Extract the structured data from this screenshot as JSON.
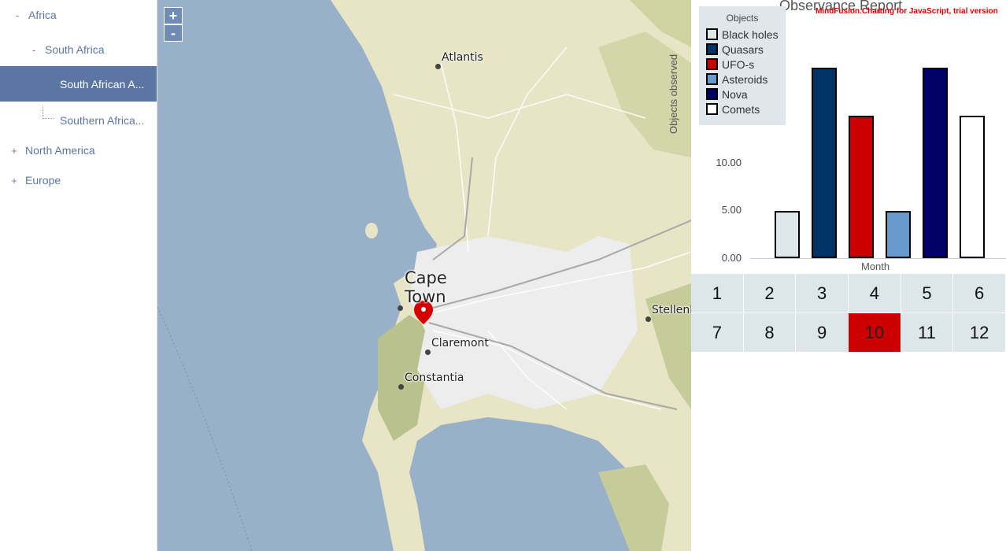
{
  "tree": {
    "nodes": [
      {
        "toggle": "-",
        "label": "Africa"
      },
      {
        "toggle": "-",
        "label": "South Africa"
      },
      {
        "toggle": "",
        "label": "South African A..."
      },
      {
        "toggle": "",
        "label": "Southern Africa..."
      },
      {
        "toggle": "+",
        "label": "North America"
      },
      {
        "toggle": "+",
        "label": "Europe"
      }
    ]
  },
  "map": {
    "zoom_in": "+",
    "zoom_out": "-",
    "labels": {
      "atlantis": "Atlantis",
      "cape": "Cape",
      "town": "Town",
      "claremont": "Claremont",
      "constantia": "Constantia",
      "stellenbosch": "Stellenb"
    }
  },
  "chart": {
    "title": "Observance Report",
    "trial_notice": "MindFusion.Charting for JavaScript, trial version",
    "legend_title": "Objects",
    "ylabel": "Objects observed",
    "xlabel": "Month",
    "yticks": [
      "10.00",
      "5.00",
      "0.00"
    ]
  },
  "chart_data": {
    "type": "bar",
    "categories": [
      "Black holes",
      "Quasars",
      "UFO-s",
      "Asteroids",
      "Nova",
      "Comets"
    ],
    "values": [
      5,
      20,
      15,
      5,
      20,
      15
    ],
    "colors": [
      "#dde6e8",
      "#003366",
      "#cc0000",
      "#6699cc",
      "#000066",
      "#ffffff"
    ],
    "title": "Observance Report",
    "xlabel": "Month",
    "ylabel": "Objects observed",
    "ylim": [
      0,
      25
    ],
    "legend": "top-left"
  },
  "months": [
    "1",
    "2",
    "3",
    "4",
    "5",
    "6",
    "7",
    "8",
    "9",
    "10",
    "11",
    "12"
  ],
  "selected_month": "10"
}
